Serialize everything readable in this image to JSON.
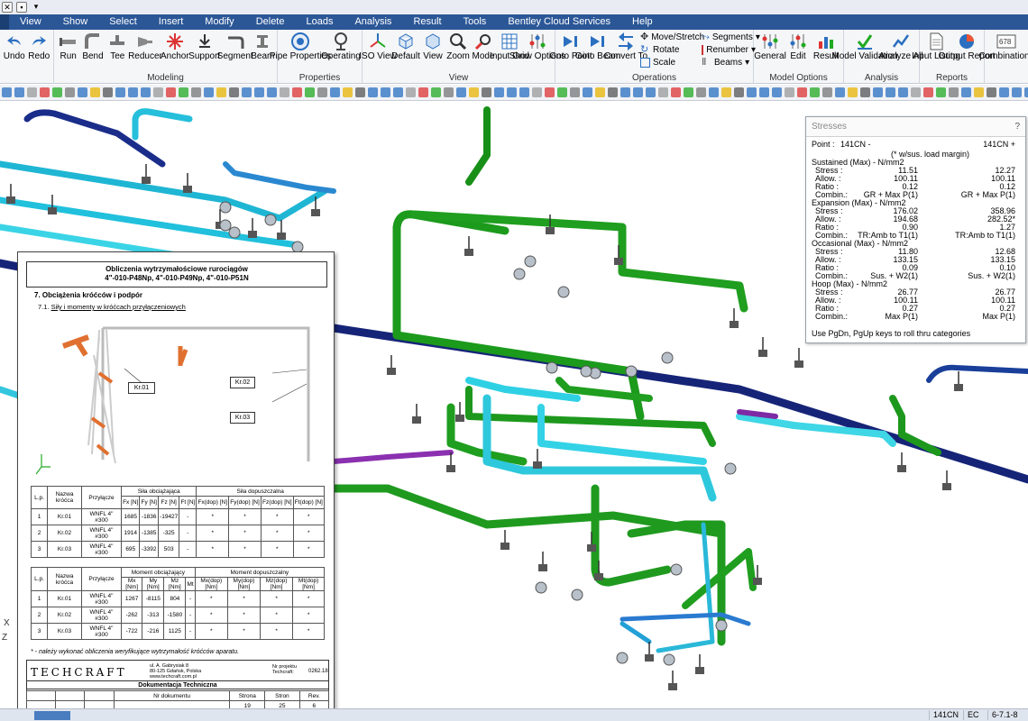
{
  "menu": [
    "View",
    "Show",
    "Select",
    "Insert",
    "Modify",
    "Delete",
    "Loads",
    "Analysis",
    "Result",
    "Tools",
    "Bentley Cloud Services",
    "Help"
  ],
  "ribbon": {
    "groups": {
      "modeling": "Modeling",
      "properties": "Properties",
      "view": "View",
      "operations": "Operations",
      "model_options": "Model Options",
      "analysis": "Analysis",
      "reports": "Reports"
    },
    "undo": "Undo",
    "redo": "Redo",
    "run": "Run",
    "bend": "Bend",
    "tee": "Tee",
    "reducer": "Reducer",
    "anchor": "Anchor",
    "support": "Support",
    "segment": "Segment",
    "beam": "Beam",
    "pipe_properties": "Pipe Properties",
    "operating": "Operating",
    "iso_view": "ISO View",
    "default": "Default",
    "view": "View",
    "zoom": "Zoom",
    "mode": "Mode",
    "input_grid": "Input Grid",
    "show_options": "Show Options",
    "goto_point": "Goto Point",
    "goto_beam": "Goto Beam",
    "convert_to": "Convert To",
    "move_stretch": "Move/Stretch",
    "rotate": "Rotate",
    "scale": "Scale",
    "segments": "Segments",
    "renumber": "Renumber",
    "beams": "Beams",
    "general": "General",
    "edit": "Edit",
    "result": "Result",
    "model_validation": "Model Validation",
    "analyze_all": "Analyze All",
    "input_listing": "Input Listing",
    "output_report": "Output Report",
    "combinations": "Combinations"
  },
  "stresses": {
    "title": "Stresses",
    "help": "?",
    "point_label": "Point :",
    "point_minus": "141CN -",
    "point_plus": "141CN +",
    "margin_note": "(* w/sus. load margin)",
    "sections": [
      {
        "head": "Sustained (Max) -       N/mm2",
        "rows": [
          [
            "Stress :",
            "11.51",
            "12.27"
          ],
          [
            "Allow. :",
            "100.11",
            "100.11"
          ],
          [
            "Ratio :",
            "0.12",
            "0.12"
          ],
          [
            "Combin.:",
            "GR + Max P(1)",
            "GR + Max P(1)"
          ]
        ]
      },
      {
        "head": "Expansion (Max) -       N/mm2",
        "rows": [
          [
            "Stress :",
            "176.02",
            "358.96"
          ],
          [
            "Allow. :",
            "194.68",
            "282.52*"
          ],
          [
            "Ratio :",
            "0.90",
            "1.27"
          ],
          [
            "Combin.:",
            "TR:Amb to T1(1)",
            "TR:Amb to T1(1)"
          ]
        ]
      },
      {
        "head": "Occasional (Max) -      N/mm2",
        "rows": [
          [
            "Stress :",
            "11.80",
            "12.68"
          ],
          [
            "Allow. :",
            "133.15",
            "133.15"
          ],
          [
            "Ratio :",
            "0.09",
            "0.10"
          ],
          [
            "Combin.:",
            "Sus. + W2(1)",
            "Sus. + W2(1)"
          ]
        ]
      },
      {
        "head": "Hoop (Max) -    N/mm2",
        "rows": [
          [
            "Stress :",
            "26.77",
            "26.77"
          ],
          [
            "Allow. :",
            "100.11",
            "100.11"
          ],
          [
            "Ratio :",
            "0.27",
            "0.27"
          ],
          [
            "Combin.:",
            "Max P(1)",
            "Max P(1)"
          ]
        ]
      }
    ],
    "footer": "Use PgDn, PgUp keys to roll thru categories"
  },
  "doc": {
    "title1": "Obliczenia wytrzymałościowe rurociągów",
    "title2": "4\"-010-P48Np, 4\"-010-P49Np, 4\"-010-P51N",
    "section": "7.  Obciążenia króćców i podpór",
    "subsection_num": "7.1.",
    "subsection": "Siły i momenty w króćcach przyłączeniowych",
    "callouts": [
      "Kr.01",
      "Kr.02",
      "Kr.03"
    ],
    "forces": {
      "h_lp": "L.p.",
      "h_name": "Nazwa króćca",
      "h_conn": "Przyłącze",
      "h_load": "Siła obciążająca",
      "h_allow": "Siła dopuszczalna",
      "sub": [
        "Fx [N]",
        "Fy [N]",
        "Fz [N]",
        "Ft [N]",
        "Fx(dop) [N]",
        "Fy(dop) [N]",
        "Fz(dop) [N]",
        "Ft(dop) [N]"
      ],
      "rows": [
        [
          "1",
          "Kr.01",
          "WNFL 4\" #300",
          "1685",
          "-1836",
          "-19427",
          "-",
          "*",
          "*",
          "*",
          "*"
        ],
        [
          "2",
          "Kr.02",
          "WNFL 4\" #300",
          "1914",
          "-1385",
          "-325",
          "-",
          "*",
          "*",
          "*",
          "*"
        ],
        [
          "3",
          "Kr.03",
          "WNFL 4\" #300",
          "695",
          "-3392",
          "503",
          "-",
          "*",
          "*",
          "*",
          "*"
        ]
      ]
    },
    "moments": {
      "h_lp": "L.p.",
      "h_name": "Nazwa króćca",
      "h_conn": "Przyłącze",
      "h_load": "Moment obciążający",
      "h_allow": "Moment dopuszczalny",
      "sub": [
        "Mx [Nm]",
        "My [Nm]",
        "Mz [Nm]",
        "Mt",
        "Mx(dop) [Nm]",
        "My(dop) [Nm]",
        "Mz(dop) [Nm]",
        "Mt(dop) [Nm]"
      ],
      "rows": [
        [
          "1",
          "Kr.01",
          "WNFL 4\" #300",
          "1267",
          "-8115",
          "804",
          "-",
          "*",
          "*",
          "*",
          "*"
        ],
        [
          "2",
          "Kr.02",
          "WNFL 4\" #300",
          "-262",
          "-313",
          "-1580",
          "-",
          "*",
          "*",
          "*",
          "*"
        ],
        [
          "3",
          "Kr.03",
          "WNFL 4\" #300",
          "-722",
          "-216",
          "1125",
          "-",
          "*",
          "*",
          "*",
          "*"
        ]
      ]
    },
    "note": "* - należy wykonać obliczenia weryfikujące wytrzymałość króćców aparatu.",
    "company": "TECHCRAFT",
    "address": [
      "ul. A. Gabrysiak 8",
      "80-125 Gdańsk, Polska",
      "www.techcraft.com.pl"
    ],
    "project_label": "Nr projektu Techcraft:",
    "project_no": "0262.18",
    "doc_type": "Dokumentacja Techniczna",
    "doc_no_label": "Nr dokumentu",
    "page_label": "Strona",
    "pages_label": "Stron",
    "rev_label": "Rev.",
    "page": "19",
    "pages": "25",
    "rev": "6"
  },
  "axes": {
    "x": "X",
    "z": "Z"
  },
  "status": {
    "node": "141CN",
    "code": "EC",
    "version": "6-7.1-8"
  }
}
